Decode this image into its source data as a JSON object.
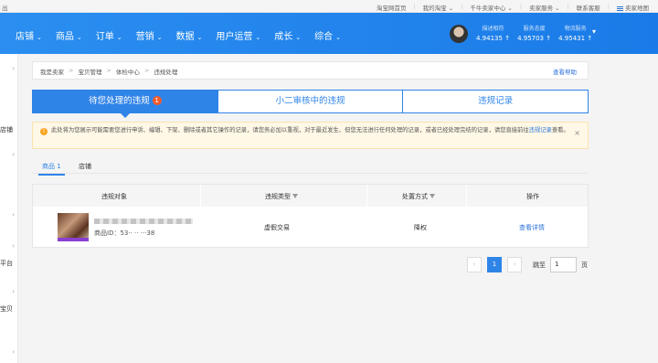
{
  "topbar": {
    "exit": "出",
    "links": [
      "淘宝网首页",
      "我的淘宝",
      "千牛卖家中心",
      "卖家服务",
      "联系客服",
      "卖家地图"
    ]
  },
  "nav": {
    "items": [
      "店铺",
      "商品",
      "订单",
      "营销",
      "数据",
      "用户运营",
      "成长",
      "综合"
    ],
    "scores": [
      {
        "label": "描述相符",
        "value": "4.94135",
        "arrow": "↑"
      },
      {
        "label": "服务态度",
        "value": "4.95703",
        "arrow": "↑"
      },
      {
        "label": "物流服务",
        "value": "4.95431",
        "arrow": "↑"
      }
    ]
  },
  "sidebar": {
    "labels": [
      "店铺",
      "平台",
      "宝贝"
    ]
  },
  "breadcrumb": {
    "items": [
      "我是卖家",
      "宝贝管理",
      "体检中心",
      "违规处理"
    ],
    "help": "查看帮助"
  },
  "tabs": [
    {
      "label": "待您处理的违规",
      "badge": "1"
    },
    {
      "label": "小二审核中的违规"
    },
    {
      "label": "违规记录"
    }
  ],
  "notice": {
    "text": "此处将为您展示可能需要您进行申诉、编辑、下架、删除或者其它操作的记录，请您务必加以重视，对于最近发生、但您无法进行任何处理的记录，或者已经处理完结的记录，请您直接前往",
    "link": "违规记录",
    "suffix": "查看。",
    "icon": "!",
    "close": "×"
  },
  "subtabs": [
    {
      "label": "商品 1"
    },
    {
      "label": "店铺"
    }
  ],
  "table": {
    "headers": [
      "违规对象",
      "违规类型",
      "处置方式",
      "操作"
    ],
    "row": {
      "product_id": "商品ID：53·· ·· ···38",
      "violation_type": "虚假交易",
      "action": "降权",
      "operation": "查看详情"
    }
  },
  "pagination": {
    "prev": "‹",
    "current": "1",
    "next": "›",
    "jump_label": "跳至",
    "page_value": "1",
    "page_unit": "页"
  }
}
